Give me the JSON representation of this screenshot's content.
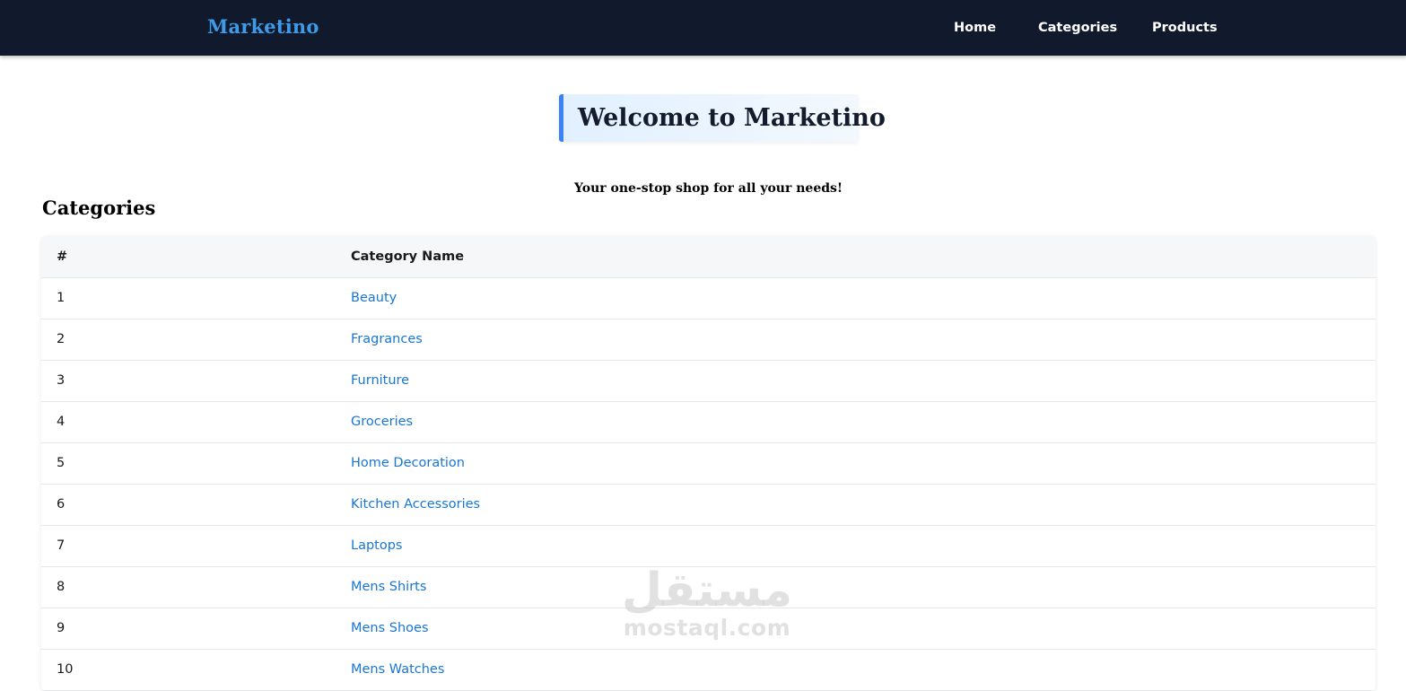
{
  "navbar": {
    "brand": "Marketino",
    "links": [
      "Home",
      "Categories",
      "Products"
    ]
  },
  "hero": {
    "title": "Welcome to Marketino",
    "tagline": "Your one-stop shop for all your needs!"
  },
  "categories": {
    "heading": "Categories",
    "columns": [
      "#",
      "Category Name"
    ],
    "rows": [
      {
        "num": "1",
        "name": "Beauty"
      },
      {
        "num": "2",
        "name": "Fragrances"
      },
      {
        "num": "3",
        "name": "Furniture"
      },
      {
        "num": "4",
        "name": "Groceries"
      },
      {
        "num": "5",
        "name": "Home Decoration"
      },
      {
        "num": "6",
        "name": "Kitchen Accessories"
      },
      {
        "num": "7",
        "name": "Laptops"
      },
      {
        "num": "8",
        "name": "Mens Shirts"
      },
      {
        "num": "9",
        "name": "Mens Shoes"
      },
      {
        "num": "10",
        "name": "Mens Watches"
      }
    ]
  },
  "watermark": {
    "arabic": "مستقل",
    "latin": "mostaql.com"
  },
  "colors": {
    "navbar_bg": "#111a2c",
    "brand": "#3d9be9",
    "accent_border": "#3b82f6",
    "link": "#1976d2"
  }
}
